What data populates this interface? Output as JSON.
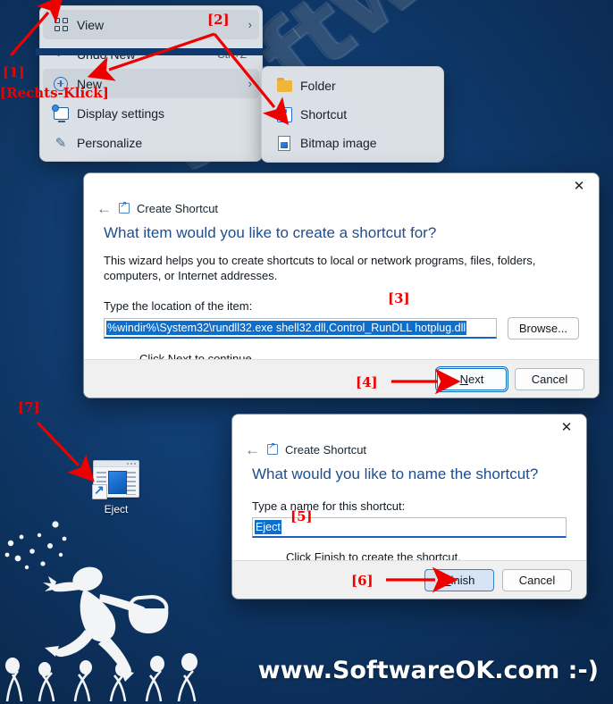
{
  "desktop": {
    "background_color": "#0e3a6f",
    "watermark": "SoftwareOK.com",
    "site_credit": "www.SoftwareOK.com :-)",
    "icon": {
      "label": "Eject",
      "icon_name": "shortcut-window-icon"
    }
  },
  "context_menu": {
    "items": [
      {
        "label": "View",
        "icon": "grid-icon",
        "accel": "",
        "submenu": true,
        "hovered": true
      },
      {
        "label": "Undo New",
        "icon": "undo-icon",
        "accel": "Ctrl+Z",
        "submenu": false,
        "hovered": false
      },
      {
        "label": "New",
        "icon": "plus-circle-icon",
        "accel": "",
        "submenu": true,
        "hovered": true
      },
      {
        "label": "Display settings",
        "icon": "display-icon",
        "accel": "",
        "submenu": false,
        "hovered": false
      },
      {
        "label": "Personalize",
        "icon": "brush-icon",
        "accel": "",
        "submenu": false,
        "hovered": false
      }
    ]
  },
  "sub_menu": {
    "items": [
      {
        "label": "Folder",
        "icon": "folder-icon"
      },
      {
        "label": "Shortcut",
        "icon": "shortcut-icon"
      },
      {
        "label": "Bitmap image",
        "icon": "bitmap-image-icon"
      }
    ]
  },
  "dialog_create_shortcut": {
    "breadcrumb": "Create Shortcut",
    "heading": "What item would you like to create a shortcut for?",
    "paragraph": "This wizard helps you to create shortcuts to local or network programs, files, folders, computers, or Internet addresses.",
    "field_label": "Type the location of the item:",
    "input_value": "%windir%\\System32\\rundll32.exe shell32.dll,Control_RunDLL hotplug.dll",
    "browse_label": "Browse...",
    "note": "Click Next to continue.",
    "next_label": "Next",
    "next_accel": "N",
    "cancel_label": "Cancel",
    "close_icon": "close-icon"
  },
  "dialog_name_shortcut": {
    "breadcrumb": "Create Shortcut",
    "heading": "What would you like to name the shortcut?",
    "field_label": "Type a name for this shortcut:",
    "input_value": "Eject",
    "note": "Click Finish to create the shortcut.",
    "finish_label": "Finish",
    "finish_accel": "F",
    "cancel_label": "Cancel",
    "close_icon": "close-icon"
  },
  "annotations": {
    "a1": "[1]",
    "a1b": "[Rechts-Klick]",
    "a2": "[2]",
    "a3": "[3]",
    "a4": "[4]",
    "a5": "[5]",
    "a6": "[6]",
    "a7": "[7]",
    "color": "#ee0000"
  }
}
